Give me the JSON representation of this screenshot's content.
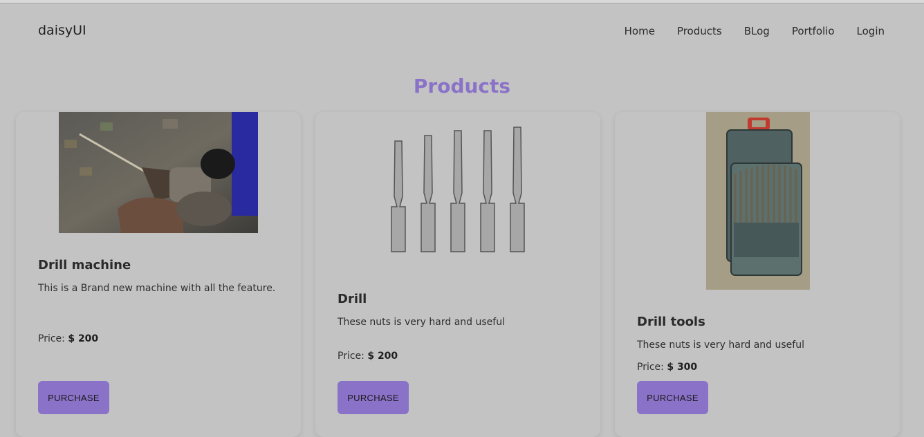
{
  "navbar": {
    "brand": "daisyUI",
    "links": [
      "Home",
      "Products",
      "BLog",
      "Portfolio",
      "Login"
    ]
  },
  "page": {
    "heading": "Products"
  },
  "products": [
    {
      "title": "Drill machine",
      "description": "This is a Brand new machine with all the feature.",
      "price_label": "Price:",
      "price": "$ 200",
      "button": "PURCHASE",
      "image_icon": "hand-drill-photo"
    },
    {
      "title": "Drill",
      "description": "These nuts is very hard and useful",
      "price_label": "Price:",
      "price": "$ 200",
      "button": "PURCHASE",
      "image_icon": "drill-bits-photo"
    },
    {
      "title": "Drill tools",
      "description": "These nuts is very hard and useful",
      "price_label": "Price:",
      "price": "$ 300",
      "button": "PURCHASE",
      "image_icon": "drill-bit-set-photo"
    }
  ],
  "colors": {
    "accent": "#8a72c8",
    "background": "#c3c3c3"
  }
}
